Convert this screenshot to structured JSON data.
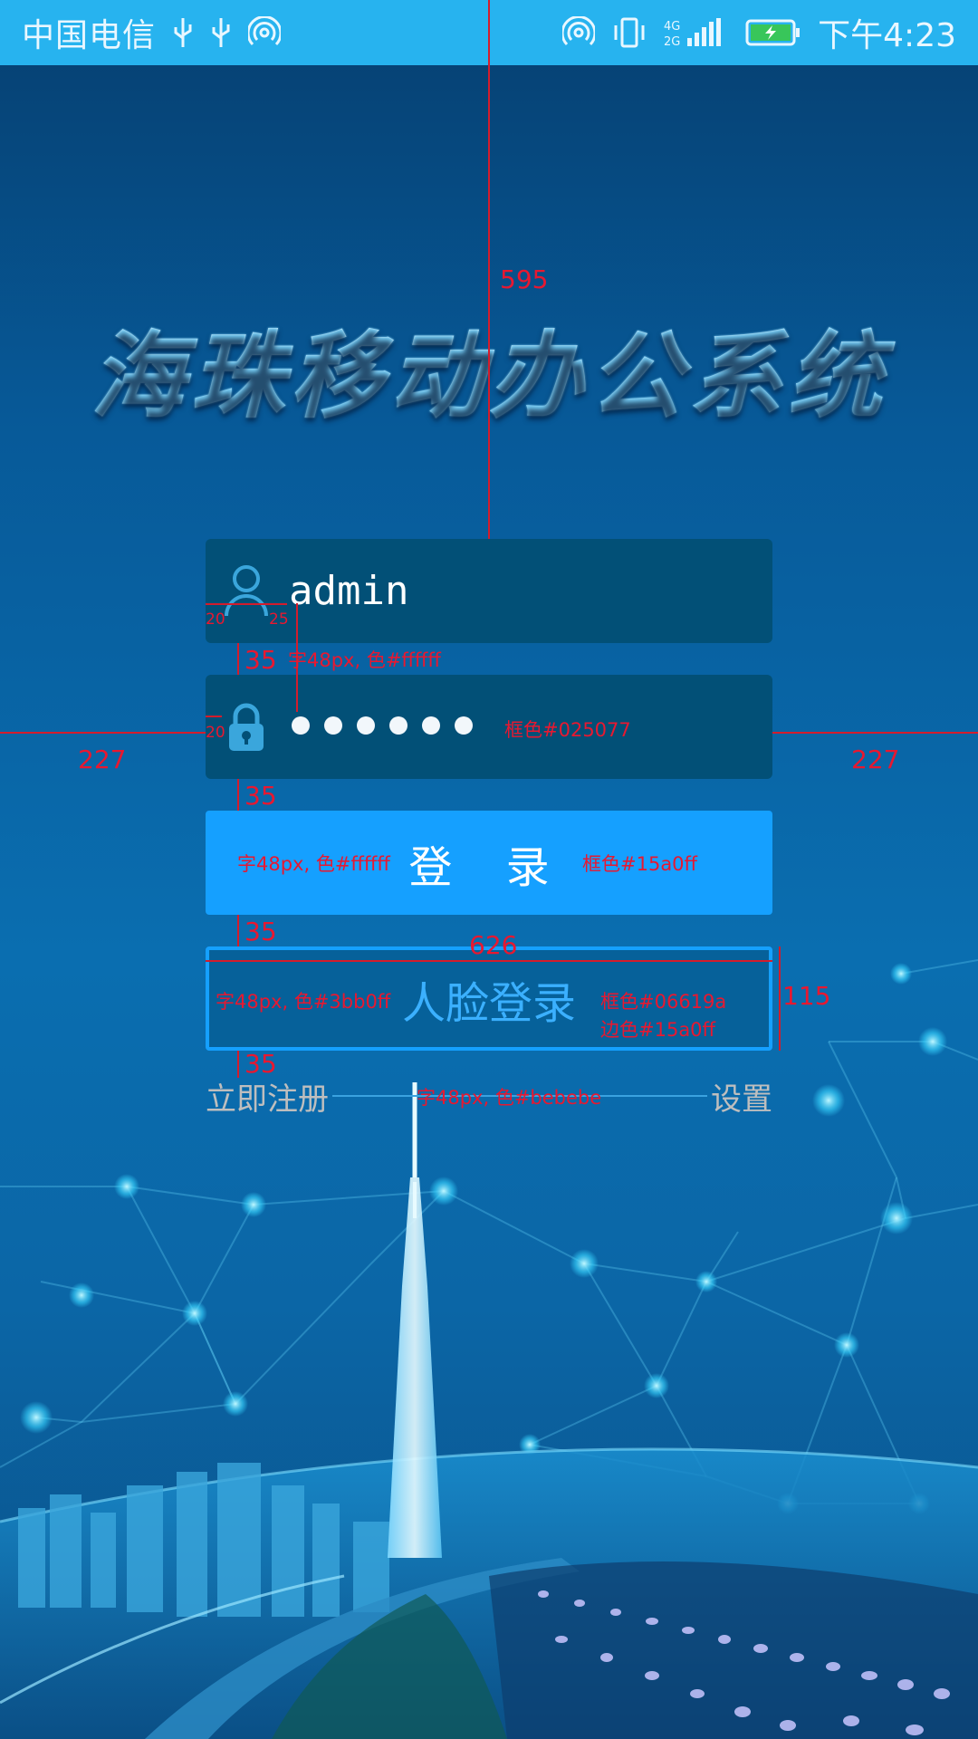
{
  "status_bar": {
    "carrier": "中国电信",
    "time": "下午4:23",
    "network_label": "4G 2G"
  },
  "app": {
    "title": "海珠移动办公系统"
  },
  "login_form": {
    "username_value": "admin",
    "password_mask_count": 6,
    "login_label": "登 录",
    "face_login_label": "人脸登录",
    "register_link": "立即注册",
    "settings_link": "设置"
  },
  "colors": {
    "field_bg": "#025077",
    "login_bg": "#15a0ff",
    "face_login_bg": "#06619a",
    "face_login_border": "#15a0ff",
    "face_login_text": "#3bb0ff",
    "links_text": "#bebebe",
    "annotation": "#e81830"
  },
  "annotations": {
    "top_offset": "595",
    "left_margin": "227",
    "right_margin": "227",
    "gap_1": "35",
    "gap_2": "35",
    "gap_3": "35",
    "gap_4": "35",
    "width": "626",
    "height": "115",
    "icon_offset_left": "20",
    "icon_offset_right": "25",
    "icon_offset_left_2": "20",
    "username_font_note": "字48px, 色#ffffff",
    "field_color_note": "框色#025077",
    "login_font_note": "字48px, 色#ffffff",
    "login_color_note": "框色#15a0ff",
    "face_font_note": "字48px, 色#3bb0ff",
    "face_color_note": "框色#06619a",
    "face_border_note": "边色#15a0ff",
    "links_font_note": "字48px, 色#bebebe"
  }
}
